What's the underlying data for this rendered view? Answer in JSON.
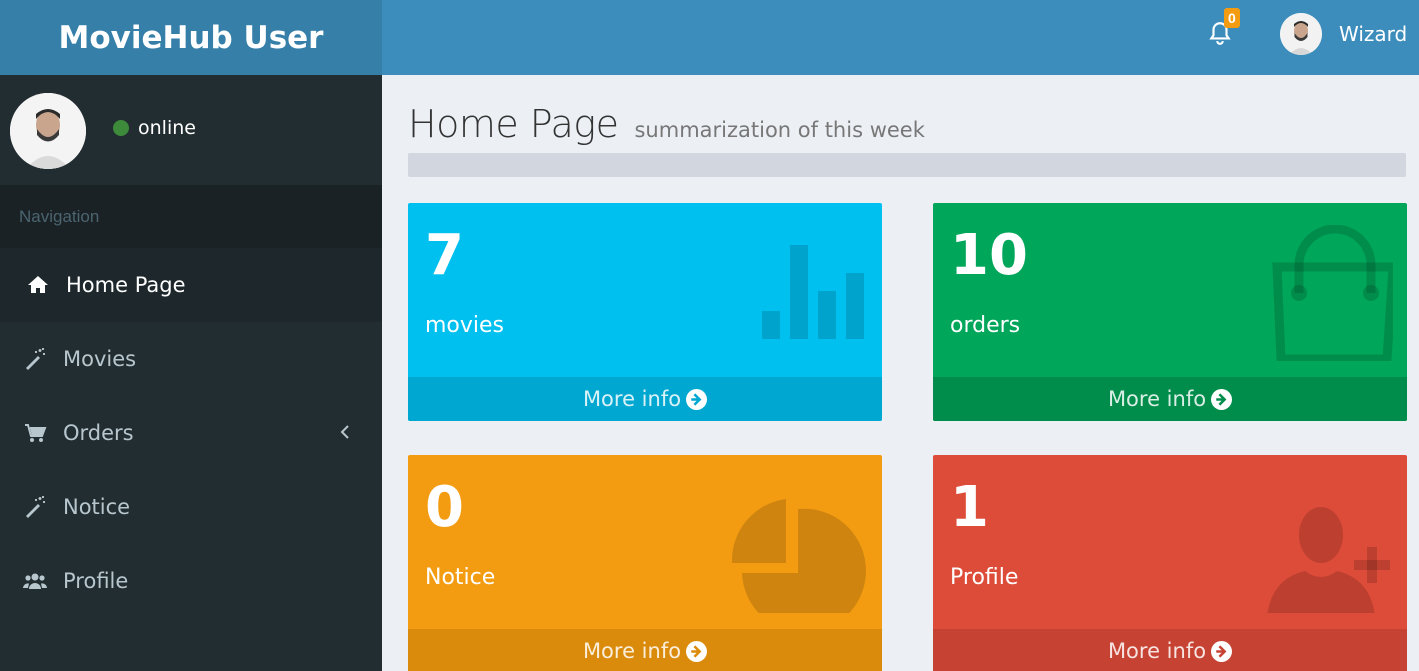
{
  "header": {
    "app_title": "MovieHub User",
    "notification_count": "0",
    "user_name": "Wizard"
  },
  "sidebar": {
    "status": "online",
    "nav_header": "Navigation",
    "items": [
      {
        "label": "Home Page",
        "icon": "home-icon"
      },
      {
        "label": "Movies",
        "icon": "magic-wand-icon"
      },
      {
        "label": "Orders",
        "icon": "cart-icon"
      },
      {
        "label": "Notice",
        "icon": "magic-wand-icon"
      },
      {
        "label": "Profile",
        "icon": "users-icon"
      }
    ]
  },
  "page": {
    "title": "Home Page",
    "subtitle": "summarization of this week"
  },
  "boxes": [
    {
      "value": "7",
      "label": "movies",
      "more": "More info",
      "icon": "bar-chart-icon",
      "color": "#00c0ef"
    },
    {
      "value": "10",
      "label": "orders",
      "more": "More info",
      "icon": "shopping-bag-icon",
      "color": "#00a65a"
    },
    {
      "value": "0",
      "label": "Notice",
      "more": "More info",
      "icon": "pie-chart-icon",
      "color": "#f39c12"
    },
    {
      "value": "1",
      "label": "Profile",
      "more": "More info",
      "icon": "add-user-icon",
      "color": "#dd4b39"
    }
  ]
}
